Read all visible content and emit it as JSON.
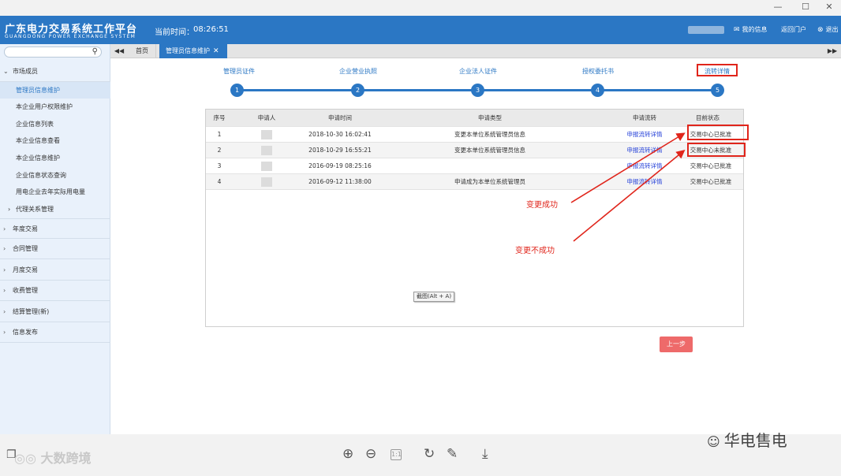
{
  "window": {
    "minimize": "—",
    "maximize": "☐",
    "close": "✕"
  },
  "header": {
    "logo_cn": "广东电力交易系统工作平台",
    "logo_en": "GUANGDONG POWER EXCHANGE SYSTEM",
    "time_label": "当前时间：",
    "time_value": "08:26:51",
    "my_info": "我的信息",
    "return_portal": "返回门户",
    "logout": "退出"
  },
  "sidebar": {
    "groups": [
      {
        "label": "市场成员",
        "expanded": true
      },
      {
        "label": "年度交易"
      },
      {
        "label": "合同管理"
      },
      {
        "label": "月度交易"
      },
      {
        "label": "收费管理"
      },
      {
        "label": "结算管理(新)"
      },
      {
        "label": "信息发布"
      }
    ],
    "sub_items": [
      {
        "label": "管理员信息维护",
        "active": true
      },
      {
        "label": "本企业用户权限维护"
      },
      {
        "label": "企业信息列表"
      },
      {
        "label": "本企业信息查看"
      },
      {
        "label": "本企业信息维护"
      },
      {
        "label": "企业信息状态查询"
      },
      {
        "label": "用电企业去年实际用电量"
      }
    ],
    "agent_item": "代理关系管理"
  },
  "tabs": {
    "home": "首页",
    "active": "管理员信息维护"
  },
  "steps": [
    {
      "label": "管理员证件",
      "num": "1"
    },
    {
      "label": "企业营业执照",
      "num": "2"
    },
    {
      "label": "企业法人证件",
      "num": "3"
    },
    {
      "label": "授权委托书",
      "num": "4"
    },
    {
      "label": "流转详情",
      "num": "5"
    }
  ],
  "table": {
    "headers": [
      "序号",
      "申请人",
      "申请时间",
      "申请类型",
      "申请流转",
      "目前状态"
    ],
    "rows": [
      {
        "no": "1",
        "time": "2018-10-30 16:02:41",
        "type": "变更本单位系统管理员信息",
        "flow": "申报流转详情",
        "status": "交易中心已批准"
      },
      {
        "no": "2",
        "time": "2018-10-29 16:55:21",
        "type": "变更本单位系统管理员信息",
        "flow": "申报流转详情",
        "status": "交易中心未批准"
      },
      {
        "no": "3",
        "time": "2016-09-19 08:25:16",
        "type": "",
        "flow": "申报流转详情",
        "status": "交易中心已批准"
      },
      {
        "no": "4",
        "time": "2016-09-12 11:38:00",
        "type": "申请成为本单位系统管理员",
        "flow": "申报流转详情",
        "status": "交易中心已批准"
      }
    ]
  },
  "annotations": {
    "success": "变更成功",
    "failure": "变更不成功"
  },
  "tooltip": "截图(Alt + A)",
  "prev_button": "上一步",
  "toolbar": {
    "page_box": "1:1"
  },
  "watermark": {
    "left": "大数跨境",
    "right": "华电售电"
  },
  "colors": {
    "header": "#2b77c4",
    "annotation": "#e0251b",
    "link": "#2440d8",
    "prev_button": "#ee6a6a"
  }
}
